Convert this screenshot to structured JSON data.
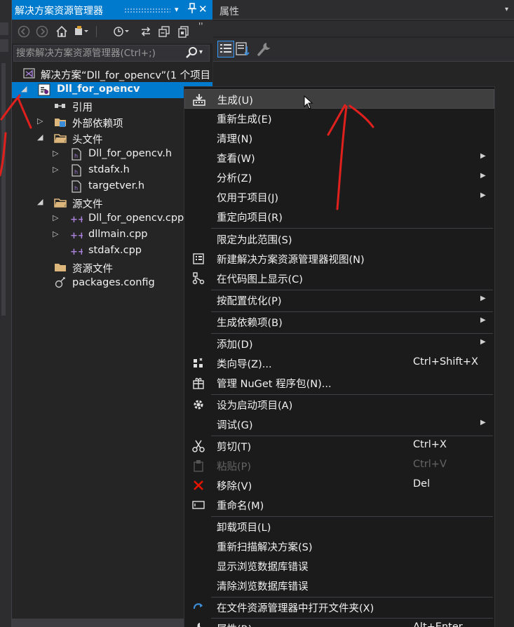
{
  "solution_explorer": {
    "title": "解决方案资源管理器",
    "title_icons": {
      "dropdown": "▾",
      "pin": "📌",
      "close": "✕"
    },
    "search_placeholder": "搜索解决方案资源管理器(Ctrl+;)",
    "tree": [
      {
        "label": "解决方案“Dll_for_opencv”(1 个项目",
        "icon": "solution-icon"
      },
      {
        "label": "Dll_for_opencv",
        "icon": "cpp-project-icon",
        "selected": true
      },
      {
        "label": "引用",
        "icon": "references-icon"
      },
      {
        "label": "外部依赖项",
        "icon": "external-deps-icon"
      },
      {
        "label": "头文件",
        "icon": "folder-icon"
      },
      {
        "label": "Dll_for_opencv.h",
        "icon": "header-file-icon"
      },
      {
        "label": "stdafx.h",
        "icon": "header-file-icon"
      },
      {
        "label": "targetver.h",
        "icon": "header-file-icon"
      },
      {
        "label": "源文件",
        "icon": "folder-icon"
      },
      {
        "label": "Dll_for_opencv.cpp",
        "icon": "cpp-file-icon"
      },
      {
        "label": "dllmain.cpp",
        "icon": "cpp-file-icon"
      },
      {
        "label": "stdafx.cpp",
        "icon": "cpp-file-icon"
      },
      {
        "label": "资源文件",
        "icon": "folder-icon"
      },
      {
        "label": "packages.config",
        "icon": "config-file-icon"
      }
    ]
  },
  "properties": {
    "title": "属性"
  },
  "context_menu": {
    "items": [
      {
        "label": "生成(U)",
        "icon": "build-icon",
        "hover": true
      },
      {
        "label": "重新生成(E)"
      },
      {
        "label": "清理(N)"
      },
      {
        "label": "查看(W)",
        "submenu": true
      },
      {
        "label": "分析(Z)",
        "submenu": true
      },
      {
        "label": "仅用于项目(J)",
        "submenu": true
      },
      {
        "label": "重定向项目(R)"
      },
      {
        "label": "限定为此范围(S)"
      },
      {
        "label": "新建解决方案资源管理器视图(N)",
        "icon": "new-view-icon"
      },
      {
        "label": "在代码图上显示(C)",
        "icon": "code-map-icon"
      },
      {
        "label": "按配置优化(P)",
        "submenu": true
      },
      {
        "label": "生成依赖项(B)",
        "submenu": true
      },
      {
        "label": "添加(D)",
        "submenu": true
      },
      {
        "label": "类向导(Z)...",
        "shortcut": "Ctrl+Shift+X",
        "icon": "class-wizard-icon"
      },
      {
        "label": "管理 NuGet 程序包(N)...",
        "icon": "nuget-icon"
      },
      {
        "label": "设为启动项目(A)",
        "icon": "gear-icon"
      },
      {
        "label": "调试(G)",
        "submenu": true
      },
      {
        "label": "剪切(T)",
        "shortcut": "Ctrl+X",
        "icon": "cut-icon"
      },
      {
        "label": "粘贴(P)",
        "shortcut": "Ctrl+V",
        "icon": "paste-icon",
        "disabled": true
      },
      {
        "label": "移除(V)",
        "shortcut": "Del",
        "icon": "remove-icon"
      },
      {
        "label": "重命名(M)",
        "icon": "rename-icon"
      },
      {
        "label": "卸载项目(L)"
      },
      {
        "label": "重新扫描解决方案(S)"
      },
      {
        "label": "显示浏览数据库错误"
      },
      {
        "label": "清除浏览数据库错误"
      },
      {
        "label": "在文件资源管理器中打开文件夹(X)",
        "icon": "refresh-arrow-icon"
      },
      {
        "label": "属性(R)",
        "shortcut": "Alt+Enter",
        "icon": "wrench-icon"
      }
    ]
  },
  "colors": {
    "accent": "#007acc",
    "panel_bg": "#252526",
    "menu_bg": "#1b1b1c",
    "annotation_red": "#e0201d"
  }
}
